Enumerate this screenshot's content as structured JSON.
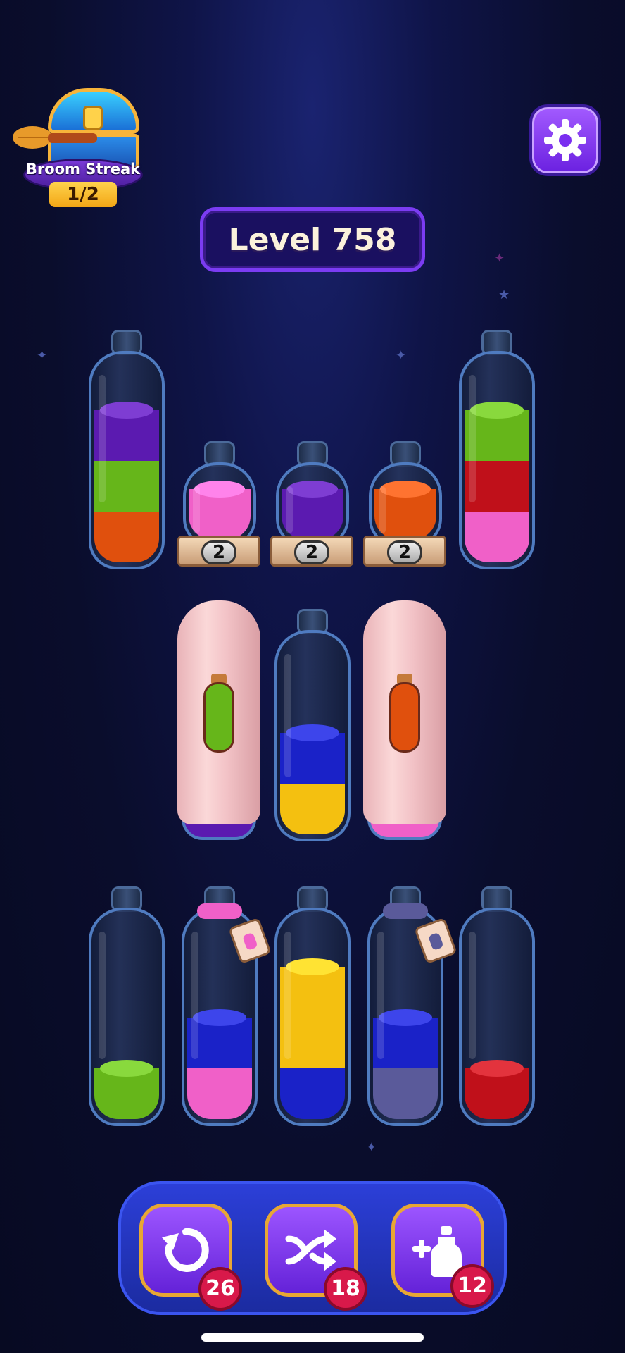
{
  "streak": {
    "label": "Broom Streak",
    "count": "1/2"
  },
  "settings": {
    "icon": "gear-icon"
  },
  "level": {
    "label": "Level 758"
  },
  "colors": {
    "purple": "#5b1ab0",
    "green": "#66b61a",
    "orange": "#e0500d",
    "pink": "#f060c8",
    "red": "#c0101a",
    "blue": "#1a22c8",
    "yellow": "#f4c010",
    "slate": "#5a5a9a"
  },
  "bottles_row1": [
    {
      "name": "bottle-1",
      "layers": [
        "purple",
        "green",
        "orange"
      ]
    },
    {
      "name": "bottle-2",
      "layers": [
        "pink"
      ],
      "locked_count": "2"
    },
    {
      "name": "bottle-3",
      "layers": [
        "purple"
      ],
      "locked_count": "2"
    },
    {
      "name": "bottle-4",
      "layers": [
        "orange"
      ],
      "locked_count": "2"
    },
    {
      "name": "bottle-5",
      "layers": [
        "green",
        "red",
        "pink"
      ]
    }
  ],
  "bottles_row2": [
    {
      "name": "covered-bottle-1",
      "covered": true,
      "hint_color": "green",
      "peek": "purple"
    },
    {
      "name": "bottle-6",
      "layers": [
        "blue",
        "yellow"
      ]
    },
    {
      "name": "covered-bottle-2",
      "covered": true,
      "hint_color": "orange",
      "peek": "pink"
    }
  ],
  "bottles_row3": [
    {
      "name": "bottle-7",
      "layers": [
        "green"
      ]
    },
    {
      "name": "bottle-8",
      "layers": [
        "blue",
        "pink"
      ],
      "tied": "pink"
    },
    {
      "name": "bottle-9",
      "layers": [
        "yellow",
        "yellow",
        "blue"
      ]
    },
    {
      "name": "bottle-10",
      "layers": [
        "blue",
        "slate"
      ],
      "tied": "slate"
    },
    {
      "name": "bottle-11",
      "layers": [
        "red"
      ]
    }
  ],
  "tools": [
    {
      "name": "undo-button",
      "icon": "undo-icon",
      "count": "26"
    },
    {
      "name": "shuffle-button",
      "icon": "shuffle-icon",
      "count": "18"
    },
    {
      "name": "add-bottle-button",
      "icon": "add-bottle-icon",
      "count": "12"
    }
  ]
}
